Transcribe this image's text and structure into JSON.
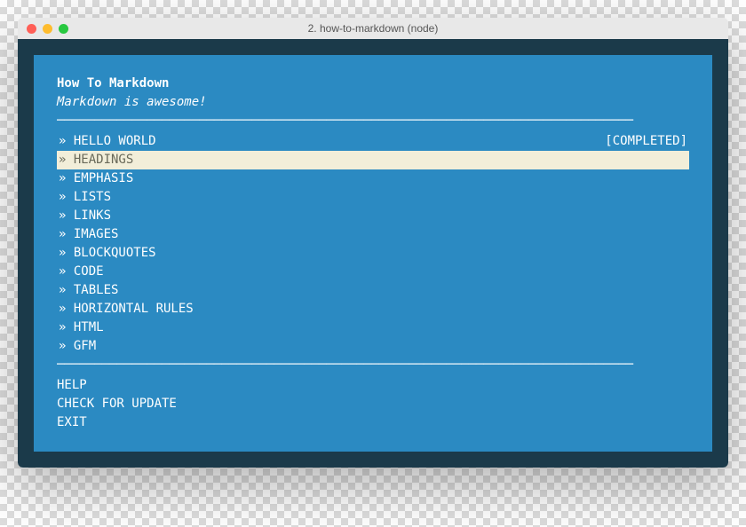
{
  "window": {
    "title": "2. how-to-markdown (node)"
  },
  "header": {
    "title": "How To Markdown",
    "subtitle": "Markdown is awesome!"
  },
  "divider": "─────────────────────────────────────────────────────────────────────────────",
  "menu": [
    {
      "label": "HELLO WORLD",
      "status": "[COMPLETED]",
      "selected": false
    },
    {
      "label": "HEADINGS",
      "status": "",
      "selected": true
    },
    {
      "label": "EMPHASIS",
      "status": "",
      "selected": false
    },
    {
      "label": "LISTS",
      "status": "",
      "selected": false
    },
    {
      "label": "LINKS",
      "status": "",
      "selected": false
    },
    {
      "label": "IMAGES",
      "status": "",
      "selected": false
    },
    {
      "label": "BLOCKQUOTES",
      "status": "",
      "selected": false
    },
    {
      "label": "CODE",
      "status": "",
      "selected": false
    },
    {
      "label": "TABLES",
      "status": "",
      "selected": false
    },
    {
      "label": "HORIZONTAL RULES",
      "status": "",
      "selected": false
    },
    {
      "label": "HTML",
      "status": "",
      "selected": false
    },
    {
      "label": "GFM",
      "status": "",
      "selected": false
    }
  ],
  "actions": [
    {
      "label": "HELP"
    },
    {
      "label": "CHECK FOR UPDATE"
    },
    {
      "label": "EXIT"
    }
  ]
}
